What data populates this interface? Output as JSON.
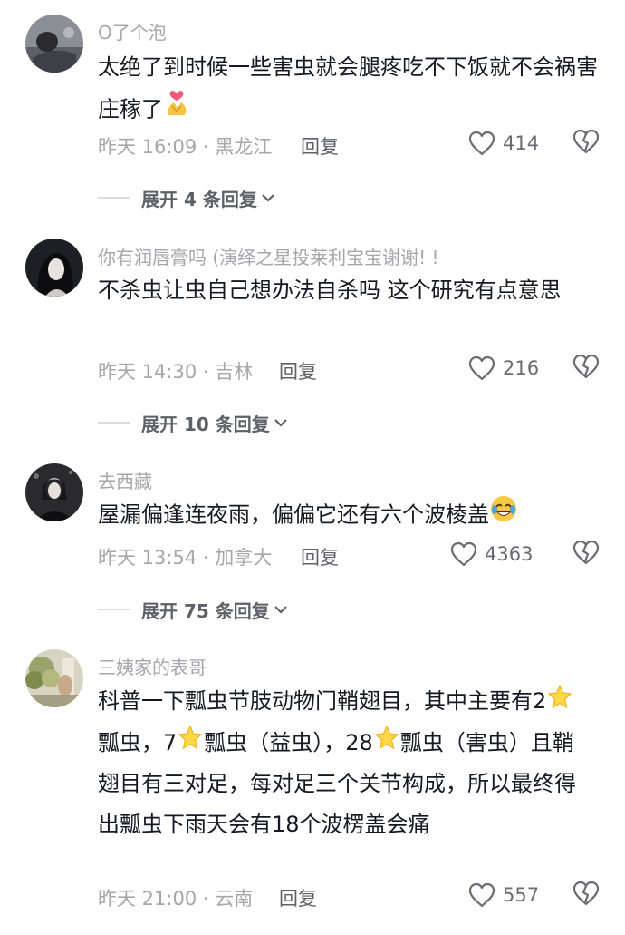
{
  "comments": [
    {
      "username": "O了个泡",
      "text": "太绝了到时候一些害虫就会腿疼吃不下饭就不会祸害庄稼了",
      "emoji": "heart-hands-emoji",
      "meta": "昨天 16:09 · 黑龙江",
      "reply_label": "回复",
      "likes": "414",
      "expand_label": "展开 4 条回复"
    },
    {
      "username": "你有润唇膏吗 (演绎之星投莱利宝宝谢谢! !",
      "text": "不杀虫让虫自己想办法自杀吗 这个研究有点意思",
      "meta": "昨天 14:30 · 吉林",
      "reply_label": "回复",
      "likes": "216",
      "expand_label": "展开 10 条回复"
    },
    {
      "username": "去西藏",
      "text": "屋漏偏逢连夜雨，偏偏它还有六个波棱盖",
      "emoji": "rofl-emoji",
      "meta": "昨天 13:54 · 加拿大",
      "reply_label": "回复",
      "likes": "4363",
      "expand_label": "展开 75 条回复"
    },
    {
      "username": "三姨家的表哥",
      "text_parts": [
        "科普一下瓢虫节肢动物门鞘翅目，其中主要有2",
        "瓢虫，7",
        "瓢虫（益虫），28",
        "瓢虫（害虫）且鞘翅目有三对足，每对足三个关节构成，所以最终得出瓢虫下雨天会有18个波楞盖会痛"
      ],
      "star_icon": "star-emoji",
      "meta": "昨天 21:00 · 云南",
      "reply_label": "回复",
      "likes": "557"
    }
  ],
  "colors": {
    "text": "#161823",
    "secondary": "#a6a6ad",
    "action": "#5f6068"
  }
}
